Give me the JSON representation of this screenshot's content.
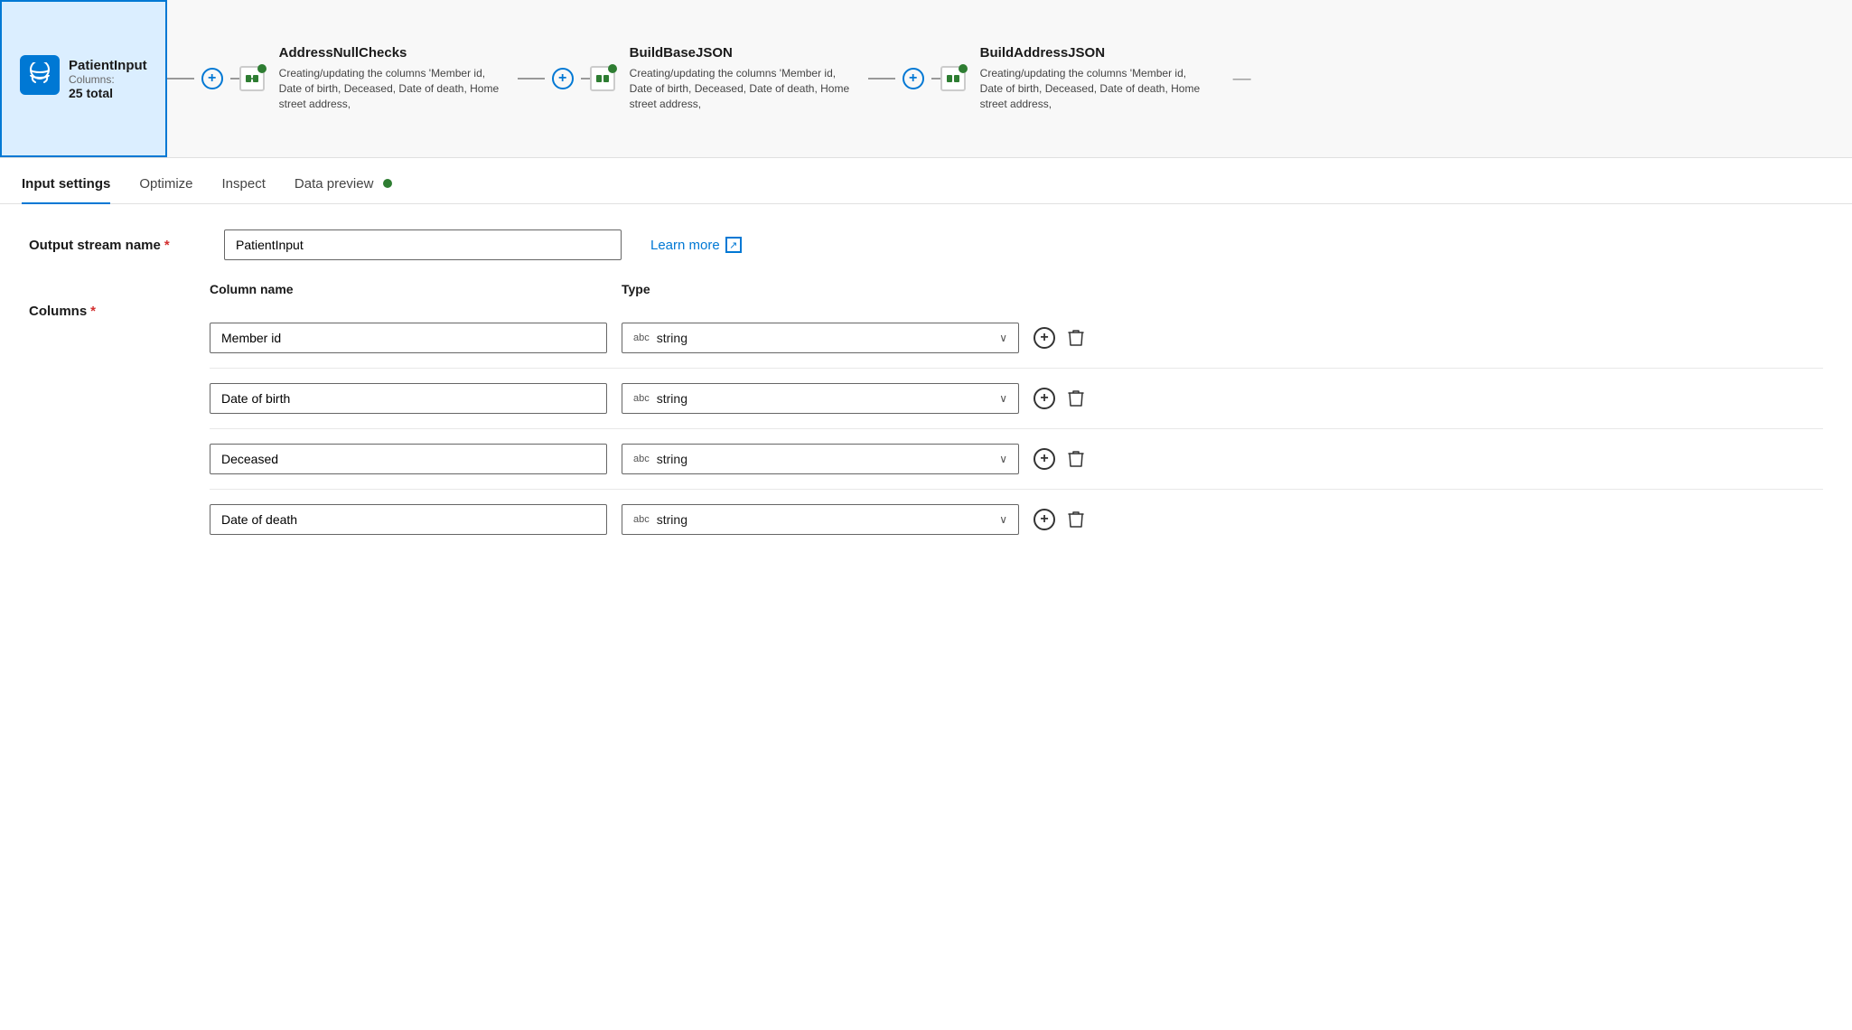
{
  "pipeline": {
    "nodes": [
      {
        "id": "patient-input",
        "title": "PatientInput",
        "subtitle": "Columns:",
        "count": "25 total",
        "active": true,
        "icon": "database-icon"
      }
    ],
    "transforms": [
      {
        "id": "address-null-checks",
        "title": "AddressNullChecks",
        "desc": "Creating/updating the columns 'Member id, Date of birth, Deceased, Date of death, Home street address,"
      },
      {
        "id": "build-base-json",
        "title": "BuildBaseJSON",
        "desc": "Creating/updating the columns 'Member id, Date of birth, Deceased, Date of death, Home street address,"
      },
      {
        "id": "build-address-json",
        "title": "BuildAddressJSON",
        "desc": "Creating/updating the columns 'Member id, Date of birth, Deceased, Date of death, Home street address,"
      }
    ],
    "scrollbar_indicator": "—"
  },
  "tabs": [
    {
      "id": "input-settings",
      "label": "Input settings",
      "active": true
    },
    {
      "id": "optimize",
      "label": "Optimize",
      "active": false
    },
    {
      "id": "inspect",
      "label": "Inspect",
      "active": false
    },
    {
      "id": "data-preview",
      "label": "Data preview",
      "active": false,
      "has_dot": true
    }
  ],
  "form": {
    "output_stream_label": "Output stream name",
    "output_stream_required": "*",
    "output_stream_value": "PatientInput",
    "learn_more_label": "Learn more",
    "columns_label": "Columns",
    "columns_required": "*",
    "col_header_name": "Column name",
    "col_header_type": "Type",
    "columns": [
      {
        "id": "col-member-id",
        "name": "Member id",
        "type": "string",
        "type_badge": "abc"
      },
      {
        "id": "col-date-of-birth",
        "name": "Date of birth",
        "type": "string",
        "type_badge": "abc"
      },
      {
        "id": "col-deceased",
        "name": "Deceased",
        "type": "string",
        "type_badge": "abc"
      },
      {
        "id": "col-date-of-death",
        "name": "Date of death",
        "type": "string",
        "type_badge": "abc"
      }
    ]
  },
  "icons": {
    "plus": "+",
    "chevron_down": "∨",
    "delete": "🗑",
    "external_link": "↗",
    "add_circle": "+"
  }
}
